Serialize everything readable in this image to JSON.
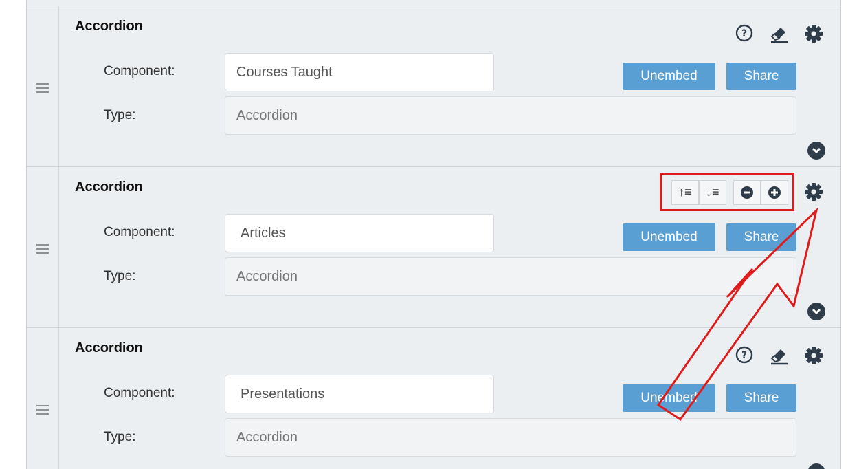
{
  "components": [
    {
      "title": "Accordion",
      "component_label": "Component:",
      "component_value": "Courses Taught",
      "type_label": "Type:",
      "type_value": "Accordion",
      "unembed_label": "Unembed",
      "share_label": "Share"
    },
    {
      "title": "Accordion",
      "component_label": "Component:",
      "component_value": "Articles",
      "type_label": "Type:",
      "type_value": "Accordion",
      "unembed_label": "Unembed",
      "share_label": "Share"
    },
    {
      "title": "Accordion",
      "component_label": "Component:",
      "component_value": "Presentations",
      "type_label": "Type:",
      "type_value": "Accordion",
      "unembed_label": "Unembed",
      "share_label": "Share"
    }
  ],
  "header_icons": [
    "help-icon",
    "eraser-icon",
    "gear-icon"
  ],
  "toolbar_icons": [
    "sort-ascending-icon",
    "sort-descending-icon",
    "collapse-all-icon",
    "expand-all-icon",
    "gear-icon"
  ],
  "colors": {
    "button": "#5a9fd4",
    "annotation": "#e01b1b",
    "icon": "#2f3c4a"
  }
}
